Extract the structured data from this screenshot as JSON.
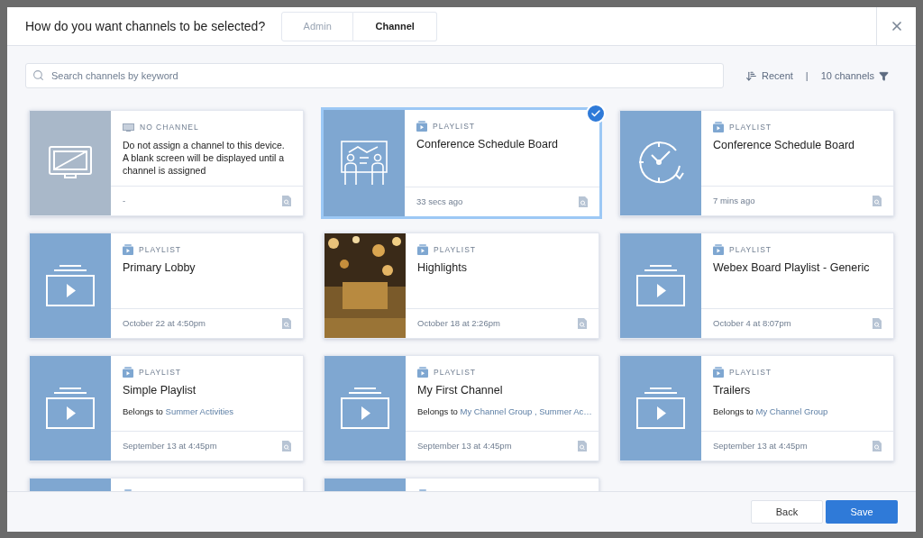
{
  "dialog": {
    "title": "How do you want channels to be selected?",
    "steps": [
      {
        "label": "Admin",
        "selected": false
      },
      {
        "label": "Channel",
        "selected": true
      }
    ]
  },
  "search": {
    "placeholder": "Search channels by keyword"
  },
  "sort": {
    "label": "Recent"
  },
  "separator": "|",
  "count": {
    "label": "10 channels"
  },
  "cards": [
    {
      "thumbnail": {
        "kind": "no-channel"
      },
      "type": {
        "kind": "no-channel",
        "label": "NO CHANNEL"
      },
      "description": "Do not assign a channel to this device. A blank screen will be displayed until a channel is assigned",
      "footer": "-",
      "selected": false
    },
    {
      "thumbnail": {
        "kind": "presenters"
      },
      "type": {
        "kind": "playlist",
        "label": "PLAYLIST"
      },
      "title": "Conference Schedule Board",
      "footer": "33 secs ago",
      "selected": true
    },
    {
      "thumbnail": {
        "kind": "clock"
      },
      "type": {
        "kind": "playlist",
        "label": "PLAYLIST"
      },
      "title": "Conference Schedule Board",
      "footer": "7 mins ago",
      "selected": false
    },
    {
      "thumbnail": {
        "kind": "playlist"
      },
      "type": {
        "kind": "playlist",
        "label": "PLAYLIST"
      },
      "title": "Primary Lobby",
      "footer": "October 22 at 4:50pm",
      "selected": false
    },
    {
      "type": {
        "kind": "playlist",
        "label": "PLAYLIST"
      },
      "title": "Highlights",
      "footer": "October 18 at 2:26pm",
      "selected": false
    },
    {
      "thumbnail": {
        "kind": "playlist"
      },
      "type": {
        "kind": "playlist",
        "label": "PLAYLIST"
      },
      "title": "Webex Board Playlist - Generic",
      "footer": "October 4 at 8:07pm",
      "selected": false
    },
    {
      "thumbnail": {
        "kind": "playlist"
      },
      "type": {
        "kind": "playlist",
        "label": "PLAYLIST"
      },
      "title": "Simple Playlist",
      "belongs_label": "Belongs to",
      "groups": "Summer Activities",
      "footer": "September 13 at 4:45pm",
      "selected": false
    },
    {
      "thumbnail": {
        "kind": "playlist"
      },
      "type": {
        "kind": "playlist",
        "label": "PLAYLIST"
      },
      "title": "My First Channel",
      "belongs_label": "Belongs to",
      "groups": "My Channel Group , Summer Ac…",
      "footer": "September 13 at 4:45pm",
      "selected": false
    },
    {
      "thumbnail": {
        "kind": "playlist"
      },
      "type": {
        "kind": "playlist",
        "label": "PLAYLIST"
      },
      "title": "Trailers",
      "belongs_label": "Belongs to",
      "groups": "My Channel Group",
      "footer": "September 13 at 4:45pm",
      "selected": false
    },
    {
      "thumbnail": {
        "kind": "cut-off"
      },
      "type": {
        "kind": "playlist"
      },
      "selected": false
    },
    {
      "thumbnail": {
        "kind": "cut-off"
      },
      "type": {
        "kind": "playlist"
      },
      "selected": false
    }
  ],
  "buttons": [
    {
      "label": "Back",
      "kind": "secondary"
    },
    {
      "label": "Save",
      "kind": "primary"
    }
  ]
}
